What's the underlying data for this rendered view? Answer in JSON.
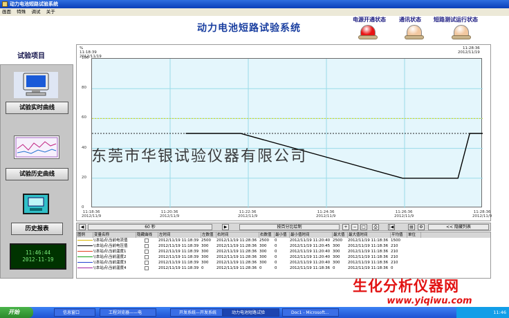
{
  "window": {
    "title": "动力电池短路试验系统"
  },
  "menu": [
    "画面",
    "特殊",
    "调试",
    "关于"
  ],
  "app_title": "动力电池短路试验系统",
  "status": [
    {
      "label": "电源开通状态",
      "color": "#e81414"
    },
    {
      "label": "通讯状态",
      "color": "#f2c8a0"
    },
    {
      "label": "短路测试运行状态",
      "color": "#f2c8a0"
    }
  ],
  "sidebar": {
    "title": "试验项目",
    "buttons": [
      "试验实时曲线",
      "试验历史曲线",
      "历史报表"
    ],
    "clock_time": "11:46:44",
    "clock_date": "2012-11-19"
  },
  "chart_header": {
    "unit": "%",
    "left_time": "11:18:39",
    "left_date": "2012/11/19",
    "right_time": "11:28:36",
    "right_date": "2012/11/19"
  },
  "chart_data": {
    "type": "line",
    "ylim": [
      0,
      100
    ],
    "y_ticks": [
      "100",
      "80",
      "60",
      "40",
      "20",
      "0"
    ],
    "x_ticks": [
      {
        "time": "11:18:36",
        "date": "2012/11/9"
      },
      {
        "time": "11:20:36",
        "date": "2012/11/9"
      },
      {
        "time": "11:22:36",
        "date": "2012/11/9"
      },
      {
        "time": "11:24:36",
        "date": "2012/11/9"
      },
      {
        "time": "11:26:36",
        "date": "2012/11/9"
      },
      {
        "time": "11:28:36",
        "date": "2012/11/9"
      }
    ],
    "reference_lines": [
      {
        "value": 60,
        "color": "#d8d800"
      },
      {
        "value": 50,
        "color": "#222222"
      }
    ],
    "series": [
      {
        "color": "#000000",
        "x_seconds": [
          144,
          228,
          477,
          562,
          580,
          670
        ],
        "y": [
          50,
          50,
          20,
          20,
          50,
          50
        ]
      }
    ]
  },
  "controls": {
    "interval": "60 秒",
    "mode": "按百分比绘制",
    "hide_list": "<< 隐藏列表"
  },
  "table": {
    "headers": [
      "图例",
      "变量名称",
      "隐藏曲线",
      "左时间",
      "左数值",
      "右时间",
      "右数值",
      "最小值",
      "最小值时间",
      "最大值",
      "最大值时间",
      "平均值",
      "单位"
    ],
    "rows": [
      {
        "color": "#d8b400",
        "name": "\\\\本站点\\当前电流值",
        "left_time": "2012/11/19 11:18:39",
        "left_val": "2500",
        "right_time": "2012/11/19 11:28:36",
        "right_val": "2500",
        "min": "0",
        "min_time": "2012/11/19 11:20:40",
        "max": "2500",
        "max_time": "2012/11/19 11:18:36",
        "avg": "1500",
        "unit": ""
      },
      {
        "color": "#000000",
        "name": "\\\\本站点\\当前电压值",
        "left_time": "2012/11/19 11:18:39",
        "left_val": "300",
        "right_time": "2012/11/19 11:28:36",
        "right_val": "300",
        "min": "0",
        "min_time": "2012/11/19 11:20:45",
        "max": "300",
        "max_time": "2012/11/19 11:18:36",
        "avg": "210",
        "unit": ""
      },
      {
        "color": "#e04020",
        "name": "\\\\本站点\\当前温度1",
        "left_time": "2012/11/19 11:18:39",
        "left_val": "300",
        "right_time": "2012/11/19 11:28:36",
        "right_val": "300",
        "min": "0",
        "min_time": "2012/11/19 11:20:40",
        "max": "300",
        "max_time": "2012/11/19 11:18:36",
        "avg": "210",
        "unit": ""
      },
      {
        "color": "#10a010",
        "name": "\\\\本站点\\当前温度2",
        "left_time": "2012/11/19 11:18:39",
        "left_val": "300",
        "right_time": "2012/11/19 11:28:36",
        "right_val": "300",
        "min": "0",
        "min_time": "2012/11/19 11:20:40",
        "max": "300",
        "max_time": "2012/11/19 11:18:36",
        "avg": "210",
        "unit": ""
      },
      {
        "color": "#2040d0",
        "name": "\\\\本站点\\当前温度3",
        "left_time": "2012/11/19 11:18:39",
        "left_val": "300",
        "right_time": "2012/11/19 11:28:36",
        "right_val": "300",
        "min": "0",
        "min_time": "2012/11/19 11:20:40",
        "max": "300",
        "max_time": "2012/11/19 11:18:36",
        "avg": "210",
        "unit": ""
      },
      {
        "color": "#a020a0",
        "name": "\\\\本站点\\当前温度4",
        "left_time": "2012/11/19 11:18:39",
        "left_val": "0",
        "right_time": "2012/11/19 11:28:36",
        "right_val": "0",
        "min": "0",
        "min_time": "2012/11/19 11:18:36",
        "max": "0",
        "max_time": "2012/11/19 11:18:36",
        "avg": "0",
        "unit": ""
      }
    ]
  },
  "taskbar": {
    "start": "开始",
    "tasks": [
      "信息窗口",
      "工程浏览器——电",
      "开发系统—开发系统",
      "动力电池短路试验",
      "Doc1 - Microsoft..."
    ],
    "time": "11:46"
  },
  "watermark": "东莞市华银试验仪器有限公司",
  "logo": {
    "cn": "生化分析仪器网",
    "en": "www.yiqiwu.com"
  }
}
